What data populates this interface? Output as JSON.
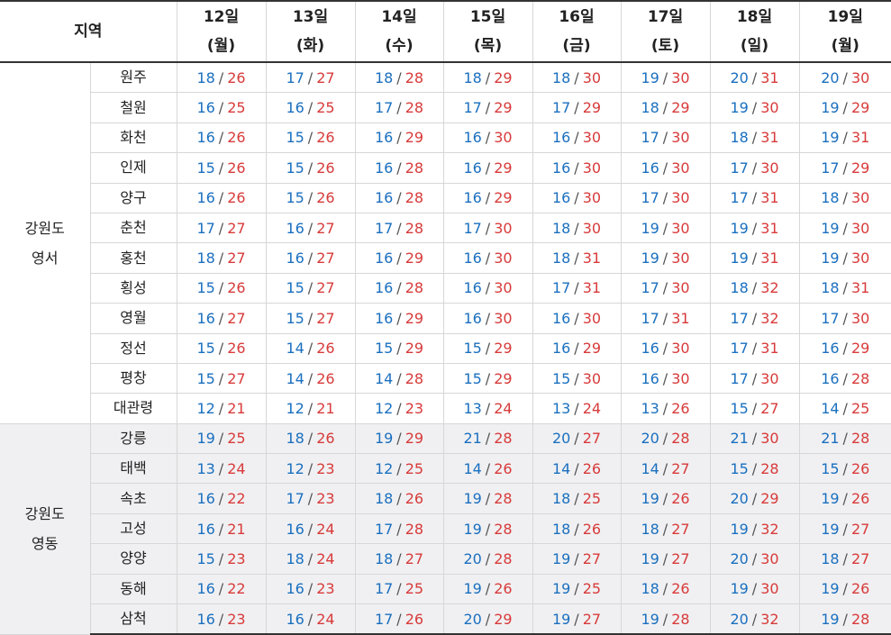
{
  "header": {
    "region_label": "지역",
    "days": [
      {
        "date": "12일",
        "weekday": "(월)"
      },
      {
        "date": "13일",
        "weekday": "(화)"
      },
      {
        "date": "14일",
        "weekday": "(수)"
      },
      {
        "date": "15일",
        "weekday": "(목)"
      },
      {
        "date": "16일",
        "weekday": "(금)"
      },
      {
        "date": "17일",
        "weekday": "(토)"
      },
      {
        "date": "18일",
        "weekday": "(일)"
      },
      {
        "date": "19일",
        "weekday": "(월)"
      }
    ]
  },
  "colors": {
    "low": "#1a6fbf",
    "high": "#d83a3a",
    "group2_bg": "#f0f0f2"
  },
  "groups": [
    {
      "province_line1": "강원도",
      "province_line2": "영서",
      "cities": [
        {
          "name": "원주",
          "temps": [
            [
              "18",
              "26"
            ],
            [
              "17",
              "27"
            ],
            [
              "18",
              "28"
            ],
            [
              "18",
              "29"
            ],
            [
              "18",
              "30"
            ],
            [
              "19",
              "30"
            ],
            [
              "20",
              "31"
            ],
            [
              "20",
              "30"
            ]
          ]
        },
        {
          "name": "철원",
          "temps": [
            [
              "16",
              "25"
            ],
            [
              "16",
              "25"
            ],
            [
              "17",
              "28"
            ],
            [
              "17",
              "29"
            ],
            [
              "17",
              "29"
            ],
            [
              "18",
              "29"
            ],
            [
              "19",
              "30"
            ],
            [
              "19",
              "29"
            ]
          ]
        },
        {
          "name": "화천",
          "temps": [
            [
              "16",
              "26"
            ],
            [
              "15",
              "26"
            ],
            [
              "16",
              "29"
            ],
            [
              "16",
              "30"
            ],
            [
              "16",
              "30"
            ],
            [
              "17",
              "30"
            ],
            [
              "18",
              "31"
            ],
            [
              "19",
              "31"
            ]
          ]
        },
        {
          "name": "인제",
          "temps": [
            [
              "15",
              "26"
            ],
            [
              "15",
              "26"
            ],
            [
              "16",
              "28"
            ],
            [
              "16",
              "29"
            ],
            [
              "16",
              "30"
            ],
            [
              "16",
              "30"
            ],
            [
              "17",
              "30"
            ],
            [
              "17",
              "29"
            ]
          ]
        },
        {
          "name": "양구",
          "temps": [
            [
              "16",
              "26"
            ],
            [
              "15",
              "26"
            ],
            [
              "16",
              "28"
            ],
            [
              "16",
              "29"
            ],
            [
              "16",
              "30"
            ],
            [
              "17",
              "30"
            ],
            [
              "17",
              "31"
            ],
            [
              "18",
              "30"
            ]
          ]
        },
        {
          "name": "춘천",
          "temps": [
            [
              "17",
              "27"
            ],
            [
              "16",
              "27"
            ],
            [
              "17",
              "28"
            ],
            [
              "17",
              "30"
            ],
            [
              "18",
              "30"
            ],
            [
              "19",
              "30"
            ],
            [
              "19",
              "31"
            ],
            [
              "19",
              "30"
            ]
          ]
        },
        {
          "name": "홍천",
          "temps": [
            [
              "18",
              "27"
            ],
            [
              "16",
              "27"
            ],
            [
              "16",
              "29"
            ],
            [
              "16",
              "30"
            ],
            [
              "18",
              "31"
            ],
            [
              "19",
              "30"
            ],
            [
              "19",
              "31"
            ],
            [
              "19",
              "30"
            ]
          ]
        },
        {
          "name": "횡성",
          "temps": [
            [
              "15",
              "26"
            ],
            [
              "15",
              "27"
            ],
            [
              "16",
              "28"
            ],
            [
              "16",
              "30"
            ],
            [
              "17",
              "31"
            ],
            [
              "17",
              "30"
            ],
            [
              "18",
              "32"
            ],
            [
              "18",
              "31"
            ]
          ]
        },
        {
          "name": "영월",
          "temps": [
            [
              "16",
              "27"
            ],
            [
              "15",
              "27"
            ],
            [
              "16",
              "29"
            ],
            [
              "16",
              "30"
            ],
            [
              "16",
              "30"
            ],
            [
              "17",
              "31"
            ],
            [
              "17",
              "32"
            ],
            [
              "17",
              "30"
            ]
          ]
        },
        {
          "name": "정선",
          "temps": [
            [
              "15",
              "26"
            ],
            [
              "14",
              "26"
            ],
            [
              "15",
              "29"
            ],
            [
              "15",
              "29"
            ],
            [
              "16",
              "29"
            ],
            [
              "16",
              "30"
            ],
            [
              "17",
              "31"
            ],
            [
              "16",
              "29"
            ]
          ]
        },
        {
          "name": "평창",
          "temps": [
            [
              "15",
              "27"
            ],
            [
              "14",
              "26"
            ],
            [
              "14",
              "28"
            ],
            [
              "15",
              "29"
            ],
            [
              "15",
              "30"
            ],
            [
              "16",
              "30"
            ],
            [
              "17",
              "30"
            ],
            [
              "16",
              "28"
            ]
          ]
        },
        {
          "name": "대관령",
          "temps": [
            [
              "12",
              "21"
            ],
            [
              "12",
              "21"
            ],
            [
              "12",
              "23"
            ],
            [
              "13",
              "24"
            ],
            [
              "13",
              "24"
            ],
            [
              "13",
              "26"
            ],
            [
              "15",
              "27"
            ],
            [
              "14",
              "25"
            ]
          ]
        }
      ]
    },
    {
      "province_line1": "강원도",
      "province_line2": "영동",
      "cities": [
        {
          "name": "강릉",
          "temps": [
            [
              "19",
              "25"
            ],
            [
              "18",
              "26"
            ],
            [
              "19",
              "29"
            ],
            [
              "21",
              "28"
            ],
            [
              "20",
              "27"
            ],
            [
              "20",
              "28"
            ],
            [
              "21",
              "30"
            ],
            [
              "21",
              "28"
            ]
          ]
        },
        {
          "name": "태백",
          "temps": [
            [
              "13",
              "24"
            ],
            [
              "12",
              "23"
            ],
            [
              "12",
              "25"
            ],
            [
              "14",
              "26"
            ],
            [
              "14",
              "26"
            ],
            [
              "14",
              "27"
            ],
            [
              "15",
              "28"
            ],
            [
              "15",
              "26"
            ]
          ]
        },
        {
          "name": "속초",
          "temps": [
            [
              "16",
              "22"
            ],
            [
              "17",
              "23"
            ],
            [
              "18",
              "26"
            ],
            [
              "19",
              "28"
            ],
            [
              "18",
              "25"
            ],
            [
              "19",
              "26"
            ],
            [
              "20",
              "29"
            ],
            [
              "19",
              "26"
            ]
          ]
        },
        {
          "name": "고성",
          "temps": [
            [
              "16",
              "21"
            ],
            [
              "16",
              "24"
            ],
            [
              "17",
              "28"
            ],
            [
              "19",
              "28"
            ],
            [
              "18",
              "26"
            ],
            [
              "18",
              "27"
            ],
            [
              "19",
              "32"
            ],
            [
              "19",
              "27"
            ]
          ]
        },
        {
          "name": "양양",
          "temps": [
            [
              "15",
              "23"
            ],
            [
              "18",
              "24"
            ],
            [
              "18",
              "27"
            ],
            [
              "20",
              "28"
            ],
            [
              "19",
              "27"
            ],
            [
              "19",
              "27"
            ],
            [
              "20",
              "30"
            ],
            [
              "18",
              "27"
            ]
          ]
        },
        {
          "name": "동해",
          "temps": [
            [
              "16",
              "22"
            ],
            [
              "16",
              "23"
            ],
            [
              "17",
              "25"
            ],
            [
              "19",
              "26"
            ],
            [
              "19",
              "25"
            ],
            [
              "18",
              "26"
            ],
            [
              "19",
              "30"
            ],
            [
              "19",
              "26"
            ]
          ]
        },
        {
          "name": "삼척",
          "temps": [
            [
              "16",
              "23"
            ],
            [
              "16",
              "24"
            ],
            [
              "17",
              "26"
            ],
            [
              "20",
              "29"
            ],
            [
              "19",
              "27"
            ],
            [
              "19",
              "28"
            ],
            [
              "20",
              "32"
            ],
            [
              "19",
              "28"
            ]
          ]
        }
      ]
    }
  ]
}
